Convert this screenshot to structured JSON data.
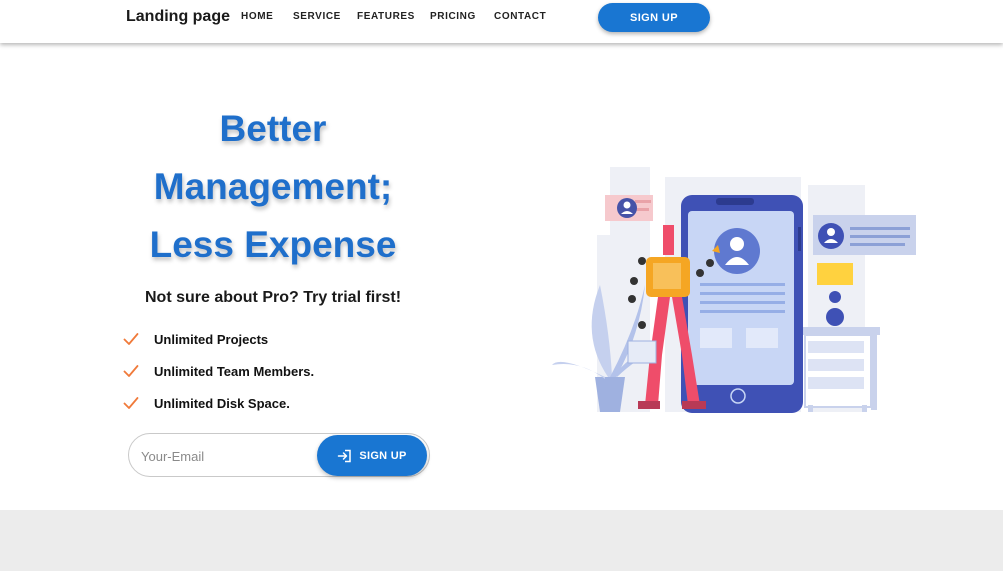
{
  "navbar": {
    "brand": "Landing page",
    "links": [
      "HOME",
      "SERVICE",
      "FEATURES",
      "PRICING",
      "CONTACT"
    ],
    "cta_label": "SIGN UP"
  },
  "hero": {
    "title_lines": [
      "Better",
      "Management;",
      "Less Expense"
    ],
    "subtitle": "Not sure about Pro? Try trial first!",
    "features": [
      "Unlimited Projects",
      "Unlimited Team Members.",
      "Unlimited Disk Space."
    ],
    "email_placeholder": "Your-Email",
    "signup_label": "SIGN UP"
  },
  "colors": {
    "accent": "#1976d2",
    "title": "#1f6fcb",
    "check": "#f07a3a",
    "footer_band": "#ececec"
  },
  "icons": {
    "feature_check": "check-icon",
    "signup": "login-arrow-icon"
  }
}
